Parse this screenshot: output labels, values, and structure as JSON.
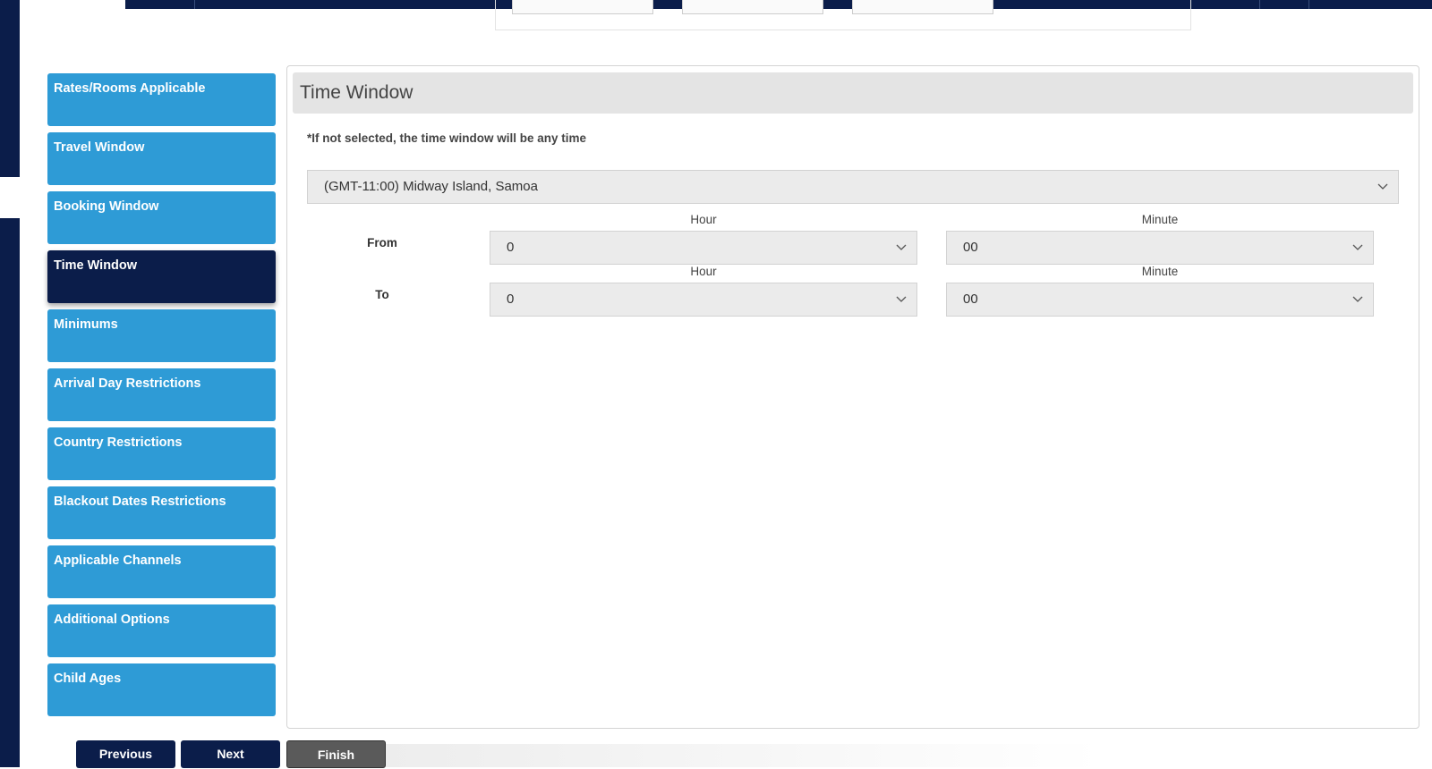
{
  "sidebar": {
    "items": [
      {
        "label": "Rates/Rooms Applicable",
        "active": false
      },
      {
        "label": "Travel Window",
        "active": false
      },
      {
        "label": "Booking Window",
        "active": false
      },
      {
        "label": "Time Window",
        "active": true
      },
      {
        "label": "Minimums",
        "active": false
      },
      {
        "label": "Arrival Day Restrictions",
        "active": false
      },
      {
        "label": "Country Restrictions",
        "active": false
      },
      {
        "label": "Blackout Dates Restrictions",
        "active": false
      },
      {
        "label": "Applicable Channels",
        "active": false
      },
      {
        "label": "Additional Options",
        "active": false
      },
      {
        "label": "Child Ages",
        "active": false
      }
    ]
  },
  "panel": {
    "title": "Time Window",
    "note": "*If not selected, the time window will be any time",
    "timezone": {
      "value": "(GMT-11:00) Midway Island, Samoa"
    },
    "from": {
      "label": "From",
      "hour_label": "Hour",
      "minute_label": "Minute",
      "hour_value": "0",
      "minute_value": "00"
    },
    "to": {
      "label": "To",
      "hour_label": "Hour",
      "minute_label": "Minute",
      "hour_value": "0",
      "minute_value": "00"
    }
  },
  "footer": {
    "previous_label": "Previous",
    "next_label": "Next",
    "finish_label": "Finish"
  },
  "colors": {
    "navy": "#0b1d4a",
    "sidebar_blue": "#2e9bd6",
    "finish_grey": "#5a5a5a"
  },
  "icons": {
    "select_caret": "chevron-down-icon"
  }
}
